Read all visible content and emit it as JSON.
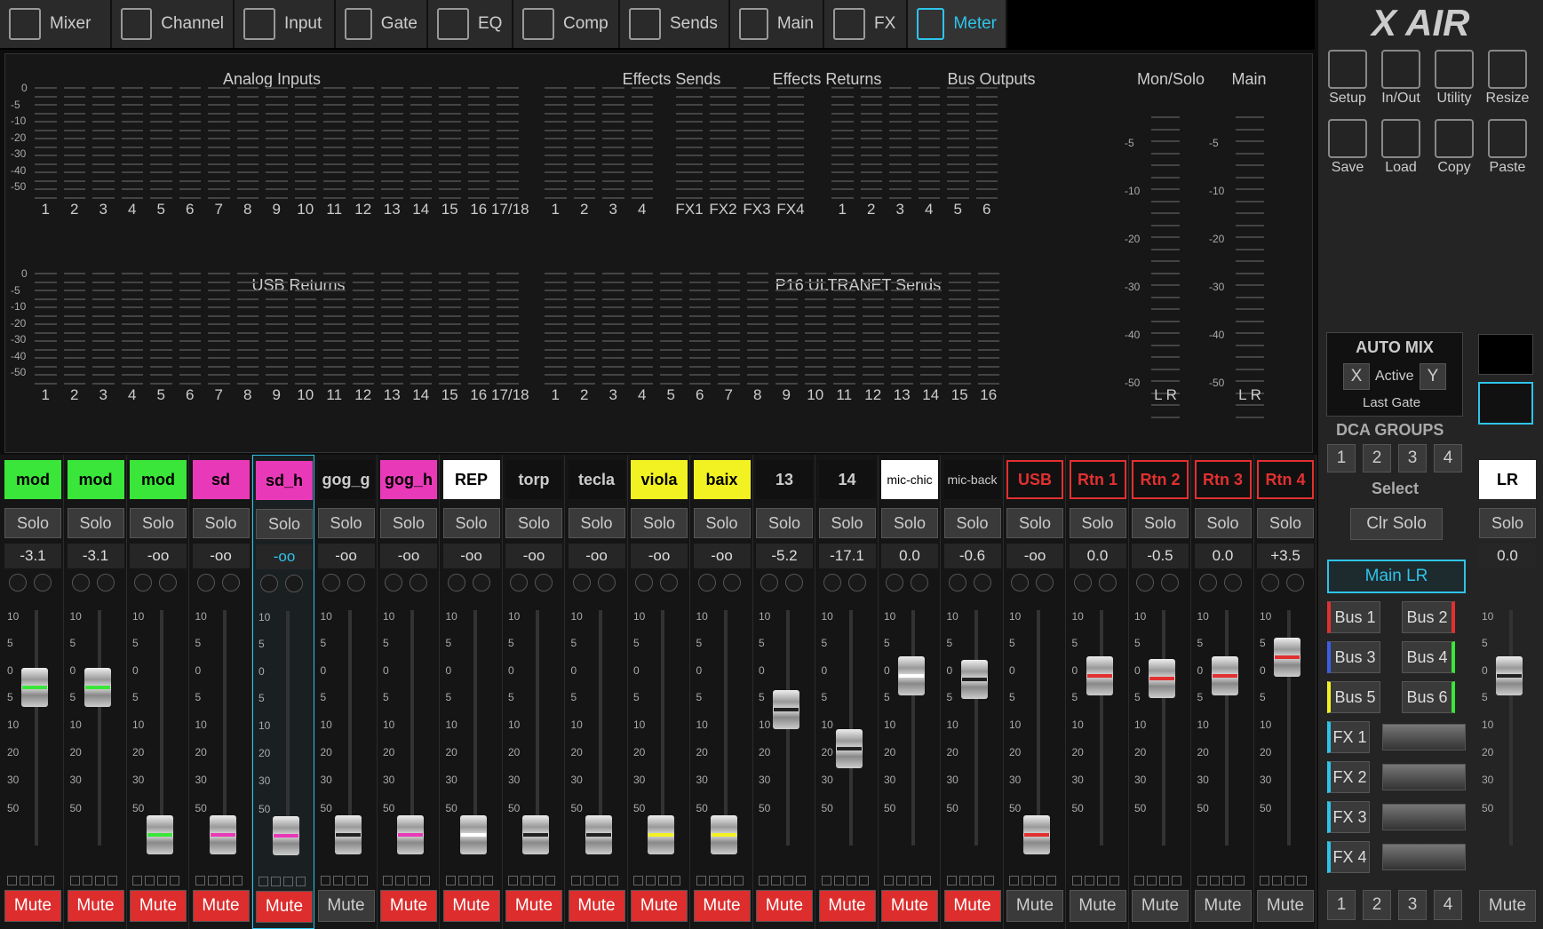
{
  "tabs": [
    "Mixer",
    "Channel",
    "Input",
    "Gate",
    "EQ",
    "Comp",
    "Sends",
    "Main",
    "FX",
    "Meter"
  ],
  "active_tab": "Meter",
  "meters": {
    "analog_title": "Analog Inputs",
    "fx_sends_title": "Effects Sends",
    "fx_returns_title": "Effects Returns",
    "bus_title": "Bus Outputs",
    "monsolo_title": "Mon/Solo",
    "main_title": "Main",
    "usb_title": "USB Returns",
    "p16_title": "P16 ULTRANET Sends",
    "analog_labels": [
      "1",
      "2",
      "3",
      "4",
      "5",
      "6",
      "7",
      "8",
      "9",
      "10",
      "11",
      "12",
      "13",
      "14",
      "15",
      "16",
      "17/18"
    ],
    "fx_send_labels": [
      "1",
      "2",
      "3",
      "4"
    ],
    "fx_return_labels": [
      "FX1",
      "FX2",
      "FX3",
      "FX4"
    ],
    "bus_labels": [
      "1",
      "2",
      "3",
      "4",
      "5",
      "6"
    ],
    "p16_labels": [
      "1",
      "2",
      "3",
      "4",
      "5",
      "6",
      "7",
      "8",
      "9",
      "10",
      "11",
      "12",
      "13",
      "14",
      "15",
      "16"
    ],
    "db_scale": [
      "0",
      "-5",
      "-10",
      "-20",
      "-30",
      "-40",
      "-50"
    ],
    "main_scale": [
      "-5",
      "-10",
      "-20",
      "-30",
      "-40",
      "-50"
    ],
    "lr_label": "L R"
  },
  "strips": [
    {
      "name": "mod",
      "color": "#39e639",
      "text": "#000",
      "value": "-3.1",
      "fader_db": -2,
      "accent": "#39e639",
      "mute": true
    },
    {
      "name": "mod",
      "color": "#39e639",
      "text": "#000",
      "value": "-3.1",
      "fader_db": -2,
      "accent": "#39e639",
      "mute": true
    },
    {
      "name": "mod",
      "color": "#39e639",
      "text": "#000",
      "value": "-oo",
      "fader_db": -60,
      "accent": "#39e639",
      "mute": true
    },
    {
      "name": "sd",
      "color": "#e83ab8",
      "text": "#000",
      "value": "-oo",
      "fader_db": -60,
      "accent": "#e83ab8",
      "mute": true
    },
    {
      "name": "sd_h",
      "color": "#e83ab8",
      "text": "#000",
      "value": "-oo",
      "fader_db": -60,
      "accent": "#e83ab8",
      "mute": true,
      "selected": true
    },
    {
      "name": "gog_g",
      "color": "#111",
      "text": "#ccc",
      "value": "-oo",
      "fader_db": -60,
      "accent": "#222",
      "mute": false
    },
    {
      "name": "gog_h",
      "color": "#e83ab8",
      "text": "#000",
      "value": "-oo",
      "fader_db": -60,
      "accent": "#e83ab8",
      "mute": true
    },
    {
      "name": "REP",
      "color": "#ffffff",
      "text": "#000",
      "value": "-oo",
      "fader_db": -60,
      "accent": "#fff",
      "mute": true
    },
    {
      "name": "torp",
      "color": "#111",
      "text": "#ccc",
      "value": "-oo",
      "fader_db": -60,
      "accent": "#222",
      "mute": true
    },
    {
      "name": "tecla",
      "color": "#111",
      "text": "#ccc",
      "value": "-oo",
      "fader_db": -60,
      "accent": "#222",
      "mute": true
    },
    {
      "name": "viola",
      "color": "#f2f222",
      "text": "#000",
      "value": "-oo",
      "fader_db": -60,
      "accent": "#f2f222",
      "mute": true
    },
    {
      "name": "baix",
      "color": "#f2f222",
      "text": "#000",
      "value": "-oo",
      "fader_db": -60,
      "accent": "#f2f222",
      "mute": true
    },
    {
      "name": "13",
      "color": "#111",
      "text": "#ccc",
      "value": "-5.2",
      "fader_db": -6,
      "accent": "#222",
      "mute": true
    },
    {
      "name": "14",
      "color": "#111",
      "text": "#ccc",
      "value": "-17.1",
      "fader_db": -16,
      "accent": "#222",
      "mute": true
    },
    {
      "name": "mic-chic",
      "color": "#ffffff",
      "text": "#000",
      "value": "0.0",
      "fader_db": 0,
      "accent": "#fff",
      "mute": true
    },
    {
      "name": "mic-back",
      "color": "#111",
      "text": "#ccc",
      "value": "-0.6",
      "fader_db": -0.6,
      "accent": "#222",
      "mute": true
    },
    {
      "name": "USB",
      "color": "#111",
      "text": "#e23030",
      "value": "-oo",
      "fader_db": -60,
      "accent": "#e23030",
      "mute": false,
      "outline": "#e23030"
    },
    {
      "name": "Rtn 1",
      "color": "#111",
      "text": "#e23030",
      "value": "0.0",
      "fader_db": 0,
      "accent": "#e23030",
      "mute": false,
      "outline": "#e23030"
    },
    {
      "name": "Rtn 2",
      "color": "#111",
      "text": "#e23030",
      "value": "-0.5",
      "fader_db": -0.5,
      "accent": "#e23030",
      "mute": false,
      "outline": "#e23030"
    },
    {
      "name": "Rtn 3",
      "color": "#111",
      "text": "#e23030",
      "value": "0.0",
      "fader_db": 0,
      "accent": "#e23030",
      "mute": false,
      "outline": "#e23030"
    },
    {
      "name": "Rtn 4",
      "color": "#111",
      "text": "#e23030",
      "value": "+3.5",
      "fader_db": 3.5,
      "accent": "#e23030",
      "mute": false,
      "outline": "#e23030"
    }
  ],
  "labels": {
    "solo": "Solo",
    "mute": "Mute"
  },
  "fader_scale": [
    "10",
    "5",
    "0",
    "5",
    "10",
    "20",
    "30",
    "50"
  ],
  "right": {
    "logo": "X AIR",
    "top_buttons": [
      "Setup",
      "In/Out",
      "Utility",
      "Resize"
    ],
    "file_buttons": [
      "Save",
      "Load",
      "Copy",
      "Paste"
    ],
    "automix": "AUTO MIX",
    "x": "X",
    "active": "Active",
    "y": "Y",
    "last_gate": "Last Gate",
    "dca_title": "DCA GROUPS",
    "dca": [
      "1",
      "2",
      "3",
      "4"
    ],
    "select": "Select",
    "clr_solo": "Clr Solo",
    "main_lr": "Main LR",
    "buses": [
      "Bus 1",
      "Bus 2",
      "Bus 3",
      "Bus 4",
      "Bus 5",
      "Bus 6"
    ],
    "fx": [
      "FX 1",
      "FX 2",
      "FX 3",
      "FX 4"
    ],
    "mute_groups": [
      "1",
      "2",
      "3",
      "4"
    ],
    "lr": {
      "name": "LR",
      "solo": "Solo",
      "value": "0.0",
      "mute": "Mute",
      "fader_db": 0
    }
  }
}
